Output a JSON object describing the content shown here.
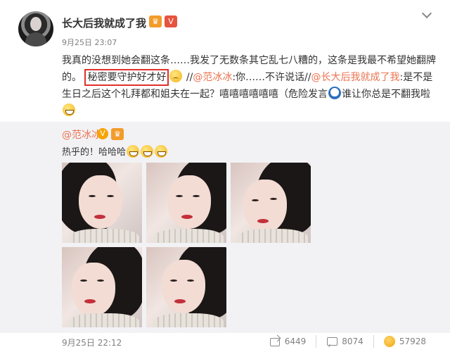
{
  "post": {
    "username": "长大后我就成了我",
    "badges": {
      "crown": "♛",
      "vip": "V"
    },
    "meta": "9月25日 23:07",
    "text": {
      "part1": "我真的没想到她会翻这条……我发了无数条其它乱七八糟的，这条是我最不希望她翻牌的。",
      "boxed": "秘密要守护好才好",
      "part2": "//",
      "mention1": "@范冰冰",
      "part3": ":你……不许说话//",
      "mention2": "@长大后我就成了我",
      "part4": ":是不是生日之后这个礼拜都和姐夫在一起？嘻嘻嘻嘻嘻嘻（危险发言",
      "part5": "谁让你总是不翻我啦"
    }
  },
  "repost": {
    "name": "@范冰冰",
    "vbadge": "V",
    "crown": "♛",
    "text": "热乎的！哈哈哈"
  },
  "footer": {
    "time": "9月25日 22:12",
    "forward_count": "6449",
    "comment_count": "8074",
    "like_count": "57928"
  }
}
